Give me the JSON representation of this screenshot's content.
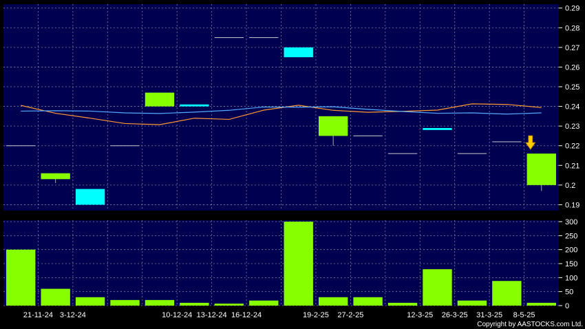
{
  "chart_data": [
    {
      "type": "candlestick",
      "categories": [
        "21-11-24",
        "3-12-24",
        "",
        "",
        "10-12-24",
        "13-12-24",
        "16-12-24",
        "",
        "19-2-25",
        "27-2-25",
        "",
        "12-3-25",
        "26-3-25",
        "31-3-25",
        "8-5-25",
        ""
      ],
      "candles": [
        {
          "o": 0.22,
          "h": 0.22,
          "l": 0.22,
          "c": 0.22
        },
        {
          "o": 0.203,
          "h": 0.206,
          "l": 0.201,
          "c": 0.206
        },
        {
          "o": 0.198,
          "h": 0.198,
          "l": 0.19,
          "c": 0.19
        },
        {
          "o": 0.22,
          "h": 0.22,
          "l": 0.22,
          "c": 0.22
        },
        {
          "o": 0.24,
          "h": 0.247,
          "l": 0.24,
          "c": 0.247
        },
        {
          "o": 0.241,
          "h": 0.241,
          "l": 0.24,
          "c": 0.24
        },
        {
          "o": 0.275,
          "h": 0.275,
          "l": 0.275,
          "c": 0.275
        },
        {
          "o": 0.275,
          "h": 0.275,
          "l": 0.275,
          "c": 0.275
        },
        {
          "o": 0.27,
          "h": 0.27,
          "l": 0.265,
          "c": 0.265
        },
        {
          "o": 0.225,
          "h": 0.235,
          "l": 0.22,
          "c": 0.235
        },
        {
          "o": 0.225,
          "h": 0.225,
          "l": 0.225,
          "c": 0.225
        },
        {
          "o": 0.216,
          "h": 0.216,
          "l": 0.216,
          "c": 0.216
        },
        {
          "o": 0.229,
          "h": 0.229,
          "l": 0.228,
          "c": 0.228
        },
        {
          "o": 0.216,
          "h": 0.216,
          "l": 0.216,
          "c": 0.216
        },
        {
          "o": 0.222,
          "h": 0.222,
          "l": 0.222,
          "c": 0.222
        },
        {
          "o": 0.2,
          "h": 0.216,
          "l": 0.197,
          "c": 0.216
        }
      ],
      "moving_averages": [
        {
          "color": "#ff9933",
          "values": [
            0.2405,
            0.2365,
            0.234,
            0.2313,
            0.2307,
            0.234,
            0.2334,
            0.2381,
            0.2406,
            0.238,
            0.237,
            0.2375,
            0.2381,
            0.2413,
            0.241,
            0.2394
          ]
        },
        {
          "color": "#55aaff",
          "values": [
            0.2376,
            0.2378,
            0.2376,
            0.2367,
            0.2364,
            0.2371,
            0.238,
            0.2397,
            0.2396,
            0.2398,
            0.2385,
            0.2374,
            0.2365,
            0.2367,
            0.2361,
            0.2367
          ]
        }
      ],
      "y_ticks": [
        0.19,
        0.2,
        0.21,
        0.22,
        0.23,
        0.24,
        0.25,
        0.26,
        0.27,
        0.28,
        0.29
      ],
      "ylim": [
        0.187,
        0.292
      ],
      "marker": {
        "type": "down-arrow",
        "color": "#ffcc00",
        "index": 15
      },
      "colors": {
        "background": "#000050",
        "up": "#88ff00",
        "down": "#00ffff",
        "grid": "#8080a0",
        "text": "#ffffff"
      }
    },
    {
      "type": "bar",
      "categories": [
        "21-11-24",
        "3-12-24",
        "",
        "",
        "10-12-24",
        "13-12-24",
        "16-12-24",
        "",
        "19-2-25",
        "27-2-25",
        "",
        "12-3-25",
        "26-3-25",
        "31-3-25",
        "8-5-25",
        ""
      ],
      "values": [
        200,
        60,
        30,
        20,
        20,
        10,
        7,
        18,
        300,
        30,
        30,
        10,
        130,
        18,
        88,
        10
      ],
      "y_ticks": [
        0,
        50,
        100,
        150,
        200,
        250,
        300
      ],
      "ylim": [
        0,
        305
      ],
      "bar_color": "#88ff00"
    }
  ],
  "credit": "Copyright by AASTOCKS.com Ltd."
}
